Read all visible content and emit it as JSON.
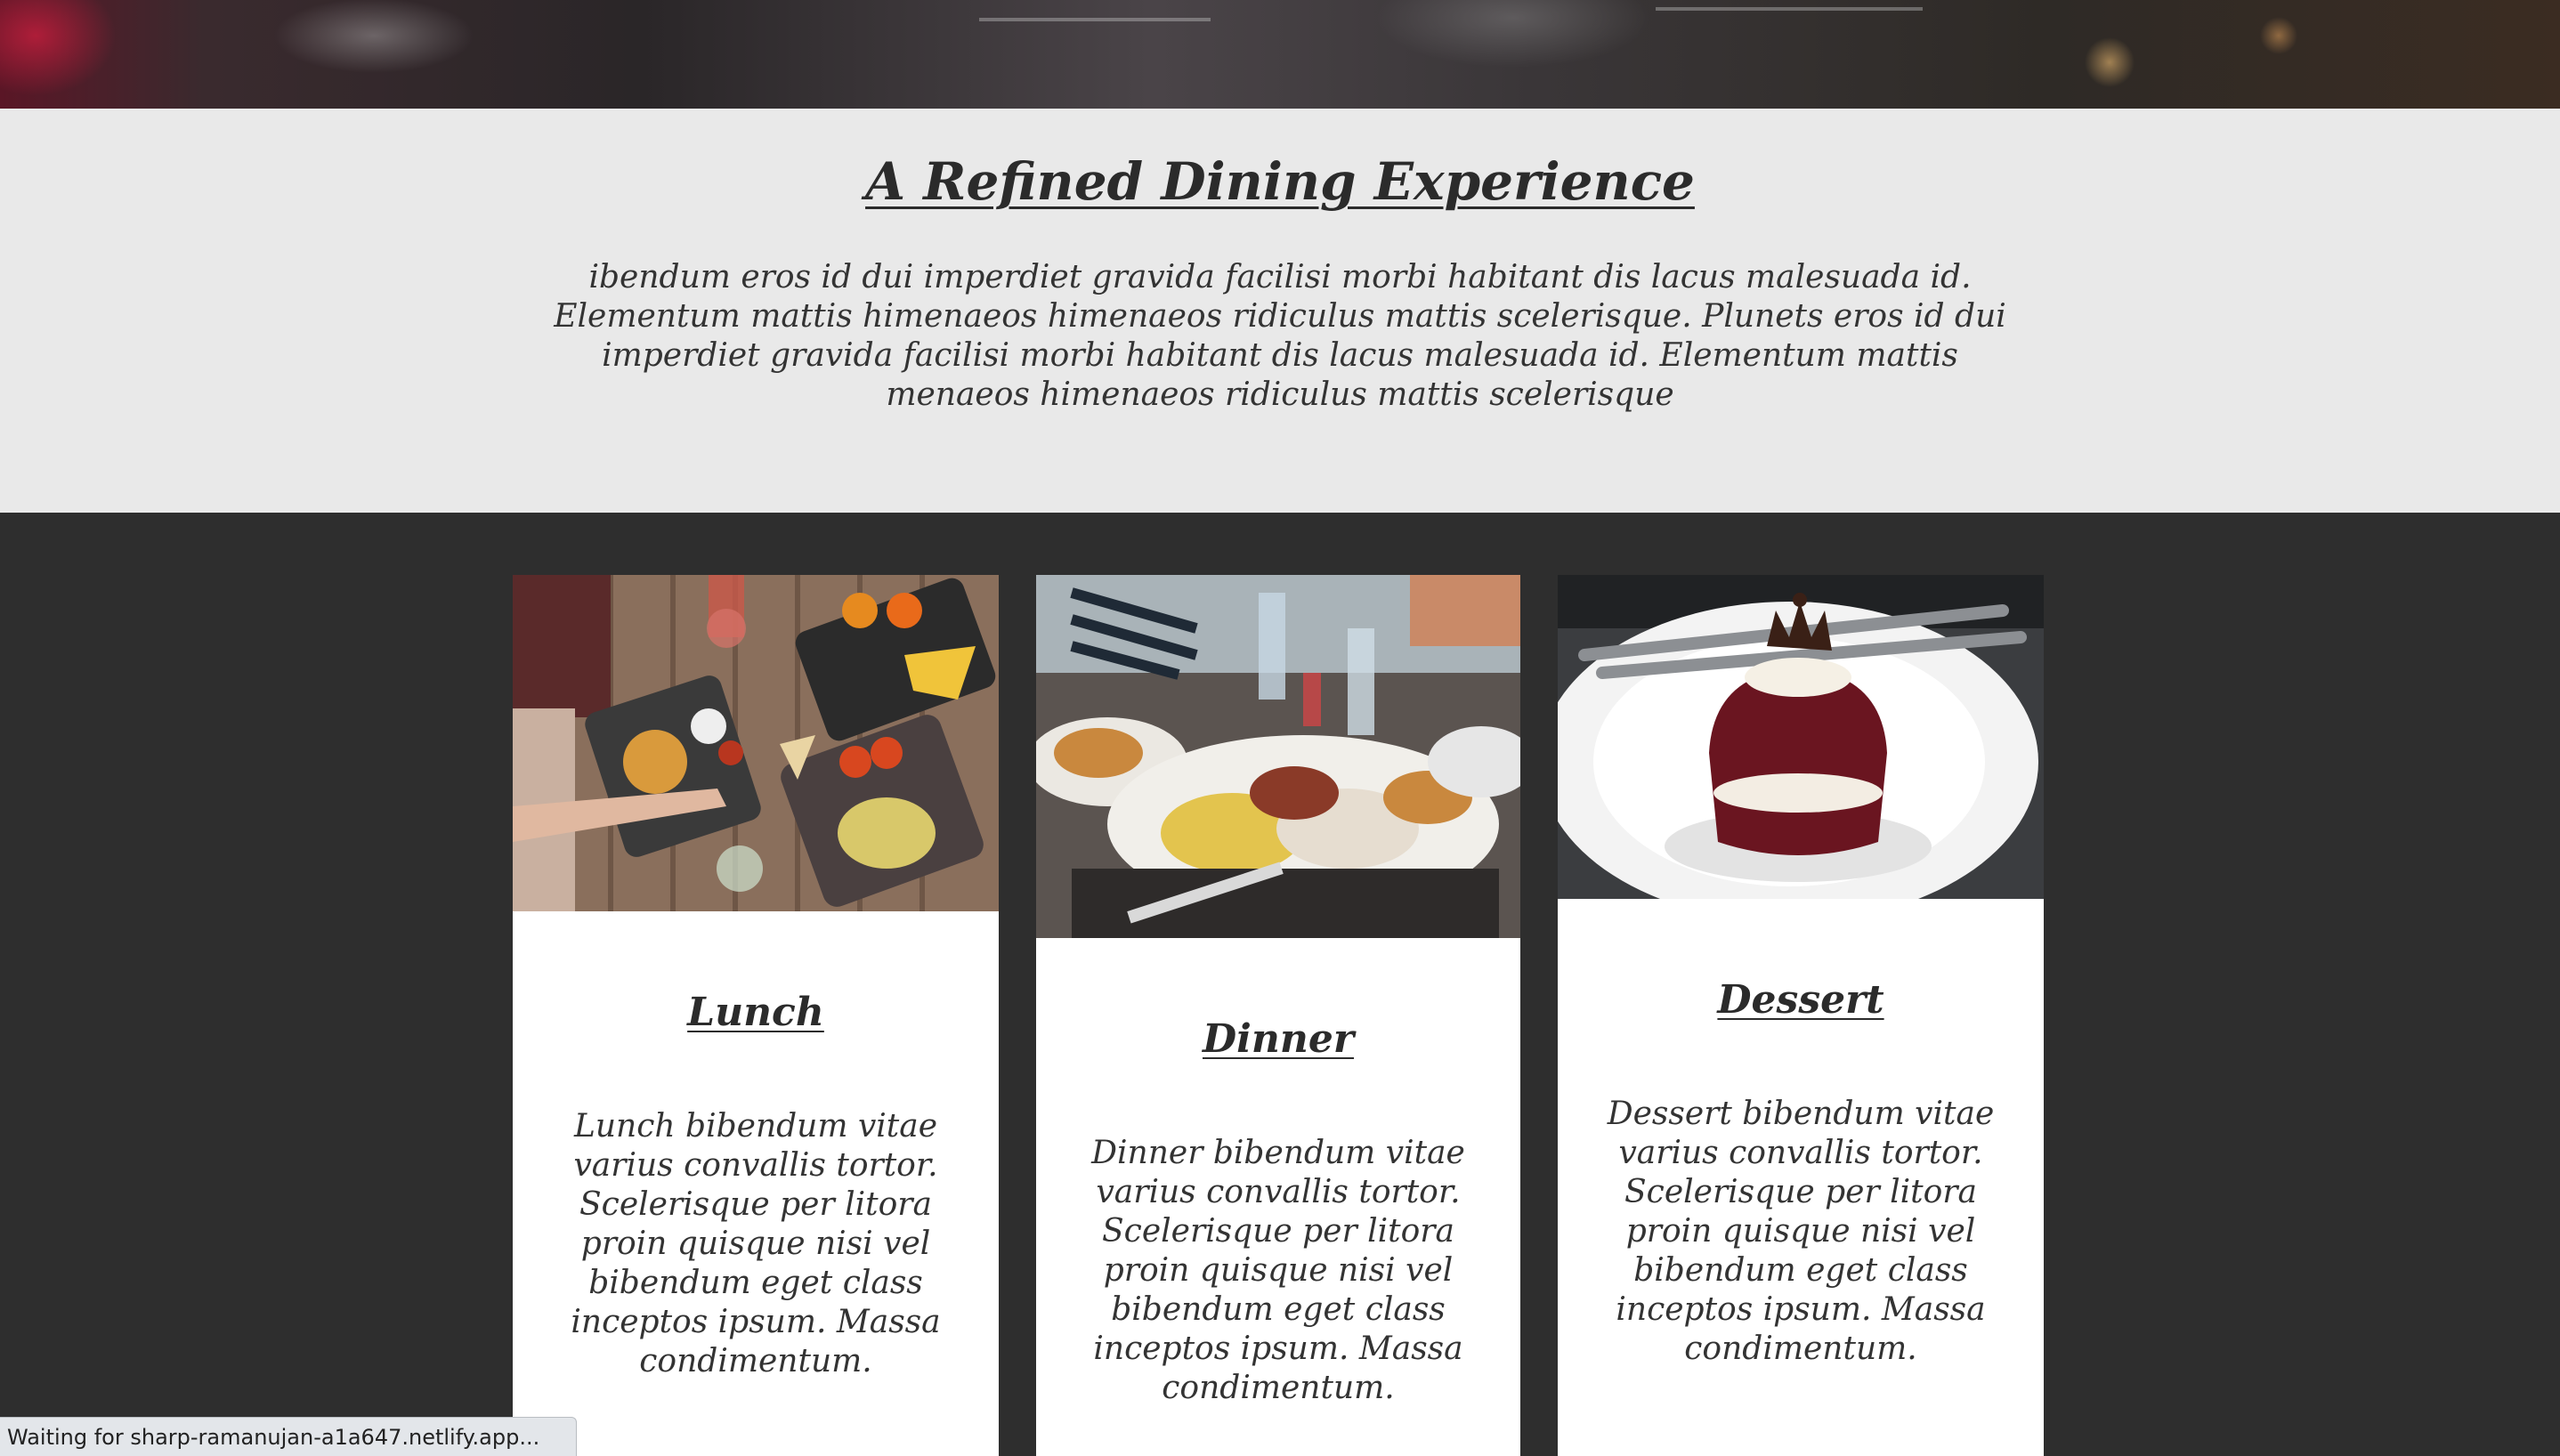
{
  "intro": {
    "title": "A Refined Dining Experience",
    "text": "ibendum eros id dui imperdiet gravida facilisi morbi habitant dis lacus malesuada id. Elementum mattis himenaeos himenaeos ridiculus mattis scelerisque. Plunets eros id dui imperdiet gravida facilisi morbi habitant dis lacus malesuada id. Elementum mattis menaeos himenaeos ridiculus mattis scelerisque"
  },
  "cards": [
    {
      "title": "Lunch",
      "text": "Lunch bibendum vitae varius convallis tortor. Scelerisque per litora proin quisque nisi vel bibendum eget class inceptos ipsum. Massa condimentum.",
      "image": "lunch-food-photo"
    },
    {
      "title": "Dinner",
      "text": "Dinner bibendum vitae varius convallis tortor. Scelerisque per litora proin quisque nisi vel bibendum eget class inceptos ipsum. Massa condimentum.",
      "image": "dinner-food-photo"
    },
    {
      "title": "Dessert",
      "text": "Dessert bibendum vitae varius convallis tortor. Scelerisque per litora proin quisque nisi vel bibendum eget class inceptos ipsum. Massa condimentum.",
      "image": "dessert-food-photo"
    }
  ],
  "status_bar": {
    "text": "Waiting for sharp-ramanujan-a1a647.netlify.app..."
  },
  "colors": {
    "page_dark": "#2e2e2e",
    "intro_bg": "#e9e9e9",
    "card_bg": "#ffffff",
    "text": "#2b2b2b"
  }
}
